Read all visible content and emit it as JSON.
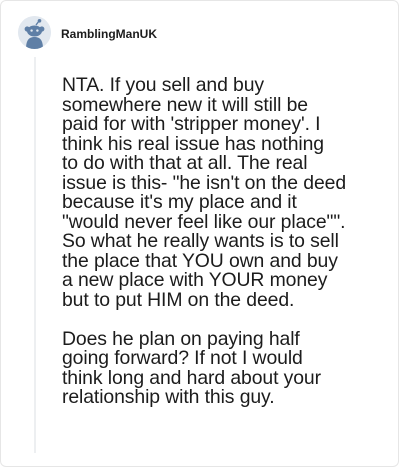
{
  "comment": {
    "username": "RamblingManUK",
    "avatar_icon": "snoo-avatar-icon",
    "paragraphs": [
      "NTA. If you sell and buy\nsomewhere new it will still be\npaid for with 'stripper money'. I\nthink his real issue has nothing\nto do with that at all. The real\nissue is this- \"he isn't on the deed\nbecause it's my place and it\n\"would never feel like our place\"\".\nSo what he really wants is to sell\nthe place that YOU own and buy\na new place with YOUR money\nbut to put HIM on the deed.",
      "Does he plan on paying half\ngoing forward? If not I would\nthink long and hard about your\nrelationship with this guy."
    ]
  },
  "colors": {
    "avatar_bg": "#e2e8ef",
    "avatar_figure": "#5f7fa6",
    "text": "#1c1c1c",
    "thread_line": "#edeff1"
  }
}
